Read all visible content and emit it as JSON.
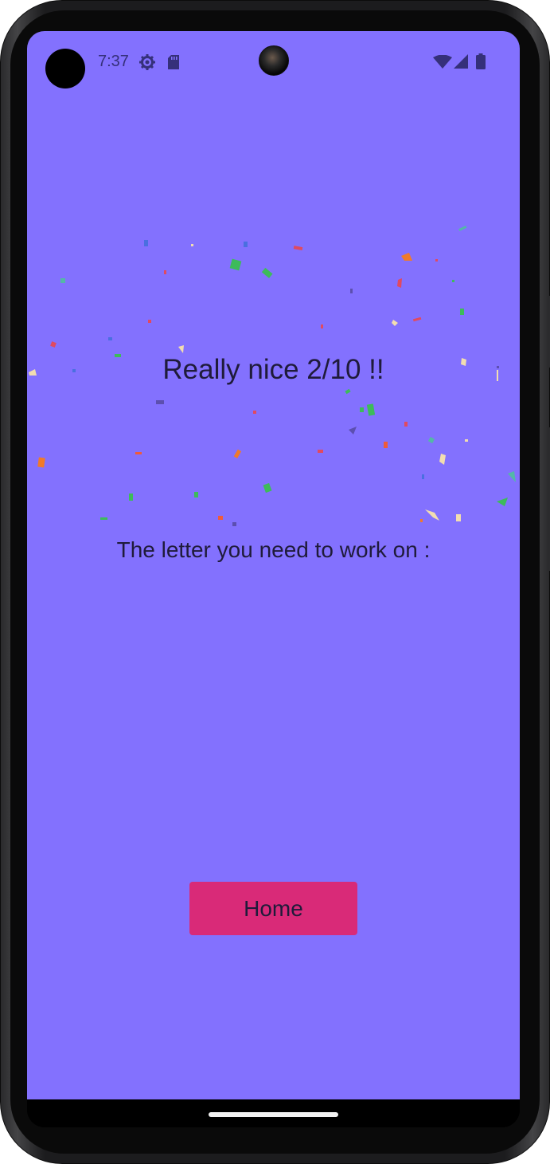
{
  "status_bar": {
    "time": "7:37",
    "left_icons": [
      "settings-gear-icon",
      "sd-card-icon"
    ],
    "right_icons": [
      "wifi-icon",
      "cellular-signal-icon",
      "battery-icon"
    ]
  },
  "result": {
    "title": "Really nice 2/10 !!",
    "subtitle": "The letter you need to work on :"
  },
  "actions": {
    "home_label": "Home"
  },
  "colors": {
    "background": "#8371fe",
    "home_button": "#d92a78",
    "text": "#1f1b3a",
    "confetti": [
      "#3dbb5a",
      "#ef5b3a",
      "#f2ddb0",
      "#4a6fe0",
      "#5c4fb0",
      "#f07a2a",
      "#e04a60",
      "#54b7a8"
    ]
  }
}
